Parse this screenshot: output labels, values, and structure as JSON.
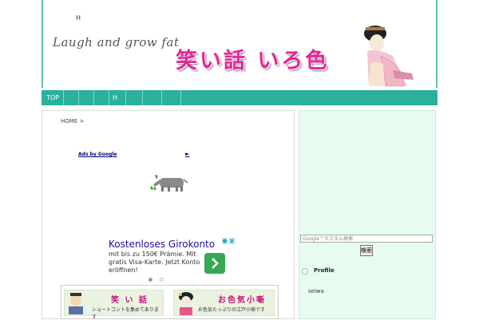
{
  "header": {
    "tagline": "H",
    "logo_en": "Laugh and grow fat",
    "logo_jp": "笑い話 いろ色"
  },
  "nav": {
    "items": [
      "TOP",
      "",
      "",
      "",
      "H",
      "",
      "",
      ""
    ]
  },
  "breadcrumb": {
    "home": "HOME",
    "sep": ">"
  },
  "ads": {
    "label": "Ads by Google",
    "arrow": "►",
    "title": "Kostenloses Girokonto",
    "text": "mit bis zu 150€ Prämie. Mit gratis Visa-Karte. Jetzt Konto eröffnen!"
  },
  "banners": [
    {
      "title": "笑 い 話",
      "sub": "ショートコントを集めてあります"
    },
    {
      "title": "お色気小噺",
      "sub": "お色気たっぷりの江戸小噺です"
    }
  ],
  "sidebar": {
    "search_placeholder": "Google™カスタム検索",
    "search_button": "検索",
    "profile_title": "Profile",
    "profile_name": "seiwa"
  },
  "colors": {
    "nav_bg": "#2bb09b",
    "sidebar_bg": "#e6fcef",
    "logo_pink": "#e6288d"
  }
}
